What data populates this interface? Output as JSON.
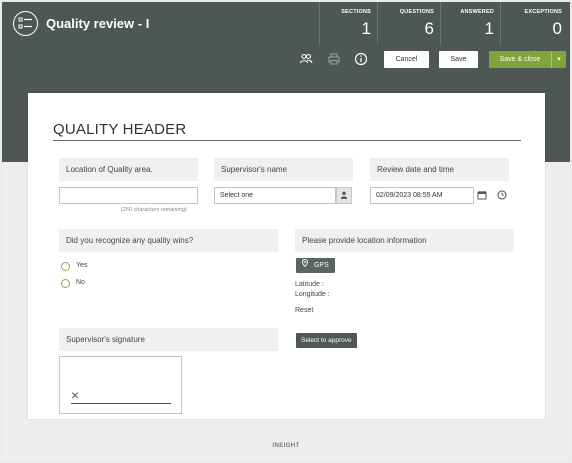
{
  "app": {
    "title": "Quality review - I",
    "logo_icon": "checklist-icon"
  },
  "stats": [
    {
      "label": "SECTIONS",
      "value": "1"
    },
    {
      "label": "QUESTIONS",
      "value": "6"
    },
    {
      "label": "ANSWERED",
      "value": "1"
    },
    {
      "label": "EXCEPTIONS",
      "value": "0"
    }
  ],
  "toolbar": {
    "icons": [
      "users-icon",
      "print-icon",
      "info-icon"
    ],
    "cancel_label": "Cancel",
    "save_label": "Save",
    "save_close_label": "Save & close",
    "caret_glyph": "▾"
  },
  "form": {
    "section_title": "QUALITY HEADER",
    "location": {
      "label": "Location of Quality area.",
      "value": "",
      "remaining": "(250 characters remaining)"
    },
    "supervisor": {
      "label": "Supervisor's name",
      "value": "Select one"
    },
    "review_date": {
      "label": "Review date and time",
      "value": "02/09/2023 08:55 AM"
    },
    "quality_wins": {
      "label": "Did you recognize any quality wins?",
      "options": [
        "Yes",
        "No"
      ]
    },
    "location_info": {
      "label": "Please provide location information",
      "gps_label": "GPS",
      "latitude_label": "Latitude :",
      "longitude_label": "Longitude :",
      "reset_label": "Reset"
    },
    "signature": {
      "label": "Supervisor's signature",
      "approve_label": "Select to approve",
      "mark": "×"
    }
  },
  "footer": {
    "brand": "INEIGHT"
  },
  "colors": {
    "header_bg": "#4e5753",
    "accent_green": "#7fa43a",
    "radio_border": "#8cae4a"
  }
}
